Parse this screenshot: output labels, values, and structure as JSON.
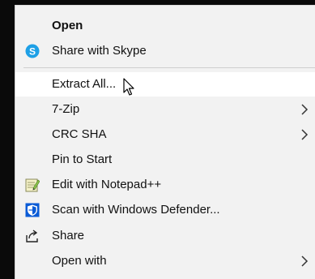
{
  "menu": {
    "items": [
      {
        "label": "Open",
        "icon": "",
        "bold": true
      },
      {
        "label": "Share with Skype",
        "icon": "skype-icon"
      },
      {
        "label": "Extract All...",
        "icon": ""
      },
      {
        "label": "7-Zip",
        "icon": "",
        "submenu": true
      },
      {
        "label": "CRC SHA",
        "icon": "",
        "submenu": true
      },
      {
        "label": "Pin to Start",
        "icon": ""
      },
      {
        "label": "Edit with Notepad++",
        "icon": "notepad-plus-plus-icon"
      },
      {
        "label": "Scan with Windows Defender...",
        "icon": "windows-defender-shield-icon"
      },
      {
        "label": "Share",
        "icon": "share-icon"
      },
      {
        "label": "Open with",
        "icon": "",
        "submenu": true
      }
    ]
  },
  "colors": {
    "menu_background": "#f2f2f2",
    "hover_background": "#ffffff",
    "skype_blue": "#1ea0e6",
    "defender_blue": "#0a5bd6"
  }
}
